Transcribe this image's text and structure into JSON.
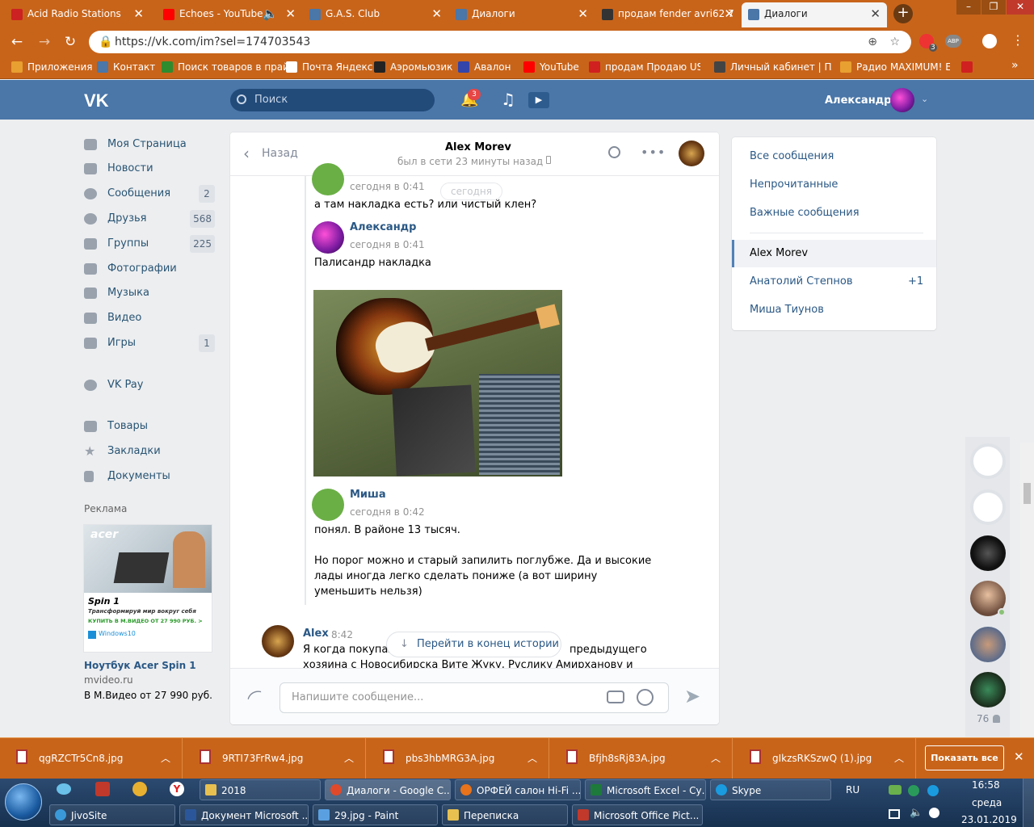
{
  "browser": {
    "tabs": [
      {
        "title": "Acid Radio Stations",
        "color": "#cc2222"
      },
      {
        "title": "Echoes - YouTube",
        "color": "#ff0000"
      },
      {
        "title": "G.A.S. Club",
        "color": "#4a76a8"
      },
      {
        "title": "Диалоги",
        "color": "#4a76a8"
      },
      {
        "title": "продам fender avri62 7",
        "color": "#333333"
      },
      {
        "title": "Диалоги",
        "color": "#4a76a8"
      }
    ],
    "url": "https://vk.com/im?sel=174703543",
    "bookmarks": [
      {
        "label": "Приложения",
        "color": "#e8a030"
      },
      {
        "label": "Контакт",
        "color": "#4a76a8"
      },
      {
        "label": "Поиск товаров в прай",
        "color": "#2e8b2e"
      },
      {
        "label": "Почта Яндекс",
        "color": "#ffffff"
      },
      {
        "label": "Аэромьюзик",
        "color": "#222222"
      },
      {
        "label": "Авалон",
        "color": "#3344aa"
      },
      {
        "label": "YouTube",
        "color": "#ff0000"
      },
      {
        "label": "продам Продаю USB-",
        "color": "#d02020"
      },
      {
        "label": "Личный кабинет | Пла",
        "color": "#444444"
      },
      {
        "label": "Радио MAXIMUM! ЕСЛ",
        "color": "#e8a030"
      }
    ],
    "profile_badge": "3",
    "abr": "ABP"
  },
  "vk": {
    "logo": "VK",
    "search_placeholder": "Поиск",
    "notifications_count": "3",
    "user_name": "Александр",
    "menu": [
      {
        "label": "Моя Страница",
        "count": ""
      },
      {
        "label": "Новости",
        "count": ""
      },
      {
        "label": "Сообщения",
        "count": "2"
      },
      {
        "label": "Друзья",
        "count": "568"
      },
      {
        "label": "Группы",
        "count": "225"
      },
      {
        "label": "Фотографии",
        "count": ""
      },
      {
        "label": "Музыка",
        "count": ""
      },
      {
        "label": "Видео",
        "count": ""
      },
      {
        "label": "Игры",
        "count": "1"
      },
      {
        "label": "VK Pay",
        "count": ""
      },
      {
        "label": "Товары",
        "count": ""
      },
      {
        "label": "Закладки",
        "count": ""
      },
      {
        "label": "Документы",
        "count": ""
      }
    ],
    "ad": {
      "heading": "Реклама",
      "image_brand": "acer",
      "image_model": "Spin 1",
      "image_slogan": "Трансформируй мир вокруг себя",
      "image_cta": "КУПИТЬ В М.ВИДЕО ОТ 27 990 РУБ. >",
      "image_os": "Windows10",
      "title": "Ноутбук Acer Spin 1",
      "domain": "mvideo.ru",
      "text": "В М.Видео от 27 990 руб."
    }
  },
  "chat": {
    "back_label": "Назад",
    "contact_name": "Alex Morev",
    "contact_status": "был в сети 23 минуты назад",
    "date_chip": "сегодня",
    "messages": [
      {
        "time": "сегодня в 0:41",
        "text": "а там накладка есть? или чистый клен?"
      },
      {
        "name": "Александр",
        "time": "сегодня в 0:41",
        "text": "Палисандр накладка"
      },
      {
        "name": "Миша",
        "time": "сегодня в 0:42",
        "text": "понял. В районе 13 тысяч.",
        "text2": "Но порог можно и старый запилить поглубже. Да и высокие лады иногда легко сделать пониже (а вот ширину уменьшить нельзя)"
      },
      {
        "name": "Alex",
        "time": "8:42",
        "text": "Я когда покупал, ... предыдущего хозяина с Новосибирска Вите Жуку, Руслику Амирханову и"
      }
    ],
    "message_text_partial_left": "Я когда покупал",
    "message_text_partial_right": "предыдущего",
    "message_line2": "хозяина с Новосибирска Вите Жуку, Руслику Амирханову и",
    "scroll_to_end": "Перейти в конец истории",
    "input_placeholder": "Напишите сообщение..."
  },
  "right_panel": {
    "filters": [
      "Все сообщения",
      "Непрочитанные",
      "Важные сообщения"
    ],
    "dialogs": [
      {
        "name": "Alex Morev",
        "badge": ""
      },
      {
        "name": "Анатолий Степнов",
        "badge": "+1"
      },
      {
        "name": "Миша Тиунов",
        "badge": ""
      }
    ]
  },
  "friends_strip": {
    "count": "76"
  },
  "downloads": {
    "files": [
      "qgRZCTr5Cn8.jpg",
      "9RTI73FrRw4.jpg",
      "pbs3hbMRG3A.jpg",
      "Bfjh8sRj83A.jpg",
      "gIkzsRKSzwQ (1).jpg"
    ],
    "show_all": "Показать все"
  },
  "taskbar": {
    "row1": [
      {
        "label": "2018",
        "color": "#e8c050"
      },
      {
        "label": "Диалоги - Google C...",
        "color": "#e04a2a"
      },
      {
        "label": "ОРФЕЙ салон Hi-Fi ...",
        "color": "#e8731a"
      },
      {
        "label": "Microsoft Excel - Су...",
        "color": "#1e7a3a"
      },
      {
        "label": "Skype",
        "color": "#1a9be0"
      }
    ],
    "row2": [
      {
        "label": "JivoSite",
        "color": "#3a9ad9"
      },
      {
        "label": "Документ Microsoft ...",
        "color": "#2b579a"
      },
      {
        "label": "29.jpg - Paint",
        "color": "#5aa0e0"
      },
      {
        "label": "Переписка",
        "color": "#e8c050"
      },
      {
        "label": "Microsoft Office Pict...",
        "color": "#c0392b"
      }
    ],
    "lang": "RU",
    "time": "16:58",
    "day": "среда",
    "date": "23.01.2019"
  }
}
